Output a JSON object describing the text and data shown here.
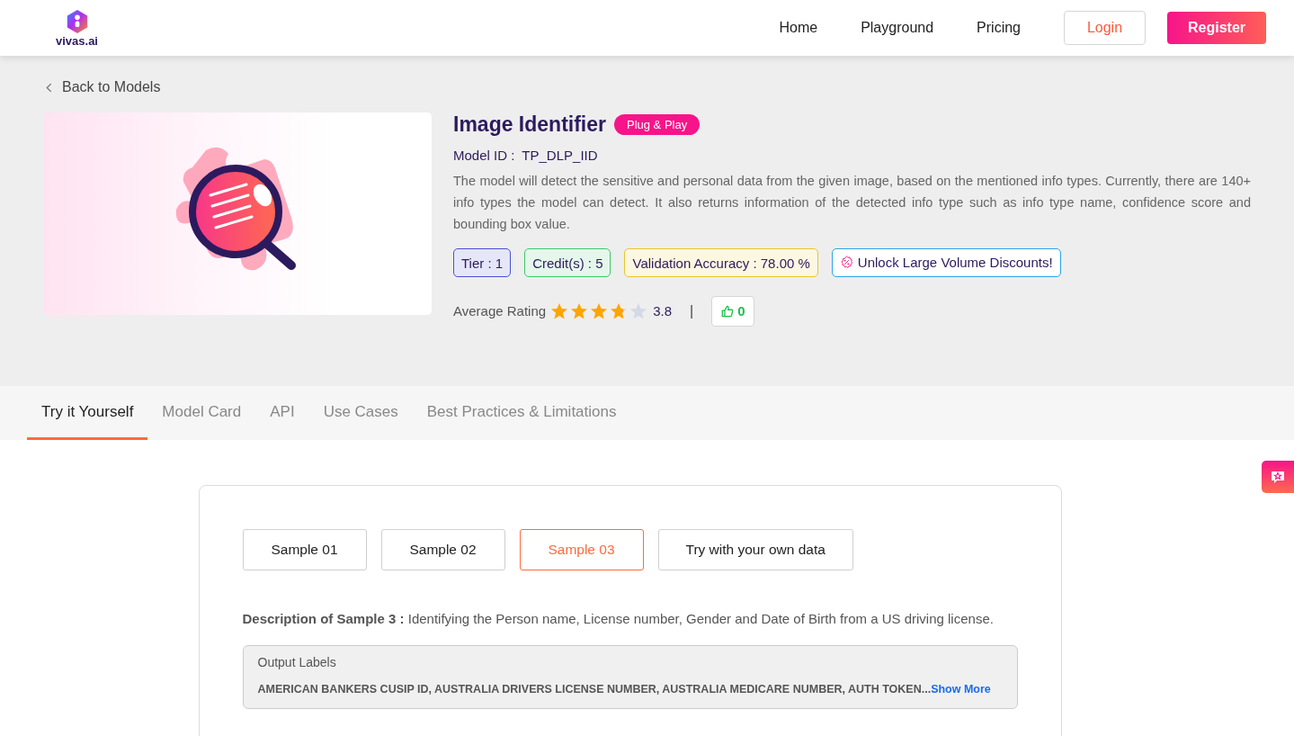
{
  "header": {
    "logo": "vivas.ai",
    "nav": [
      "Home",
      "Playground",
      "Pricing"
    ],
    "login": "Login",
    "register": "Register"
  },
  "back_link": "Back to Models",
  "model": {
    "title": "Image Identifier",
    "badge": "Plug & Play",
    "model_id_label": "Model ID :",
    "model_id": "TP_DLP_IID",
    "description": "The model will detect the sensitive and personal data from the given image, based on the mentioned info types. Currently, there are 140+ info types the model can detect. It also returns information of the detected info type such as info type name, confidence score and bounding box value.",
    "tags": [
      {
        "kind": "plain",
        "label": "Tier : 1",
        "color": "#4a4fd6"
      },
      {
        "kind": "plain",
        "label": "Credit(s) : 5",
        "color": "#3cc86a"
      },
      {
        "kind": "plain",
        "label": "Validation Accuracy : 78.00 %",
        "color": "#e8c62a"
      },
      {
        "kind": "offer",
        "label": "Unlock Large Volume Discounts!",
        "color": "#2aa4e8"
      }
    ],
    "rating_label": "Average Rating",
    "stars": 3.8,
    "rating": "3.8",
    "separator": "|",
    "likes": "0"
  },
  "tabs": [
    {
      "label": "Try it Yourself",
      "selected": true
    },
    {
      "label": "Model Card",
      "selected": false
    },
    {
      "label": "API",
      "selected": false
    },
    {
      "label": "Use Cases",
      "selected": false
    },
    {
      "label": "Best Practices & Limitations",
      "selected": false
    }
  ],
  "samples": [
    {
      "label": "Sample 01",
      "selected": false
    },
    {
      "label": "Sample 02",
      "selected": false
    },
    {
      "label": "Sample 03",
      "selected": true
    },
    {
      "label": "Try with your own data",
      "selected": false
    }
  ],
  "sample_description": "**Description of Sample 3 :** Identifying the Person name, License number, Gender and Date of Birth from a US driving license.",
  "output_labels": {
    "title": "Output Labels",
    "text": "AMERICAN BANKERS CUSIP ID, AUSTRALIA DRIVERS LICENSE NUMBER, AUSTRALIA MEDICARE NUMBER, AUTH TOKEN...",
    "link": "Show More"
  }
}
